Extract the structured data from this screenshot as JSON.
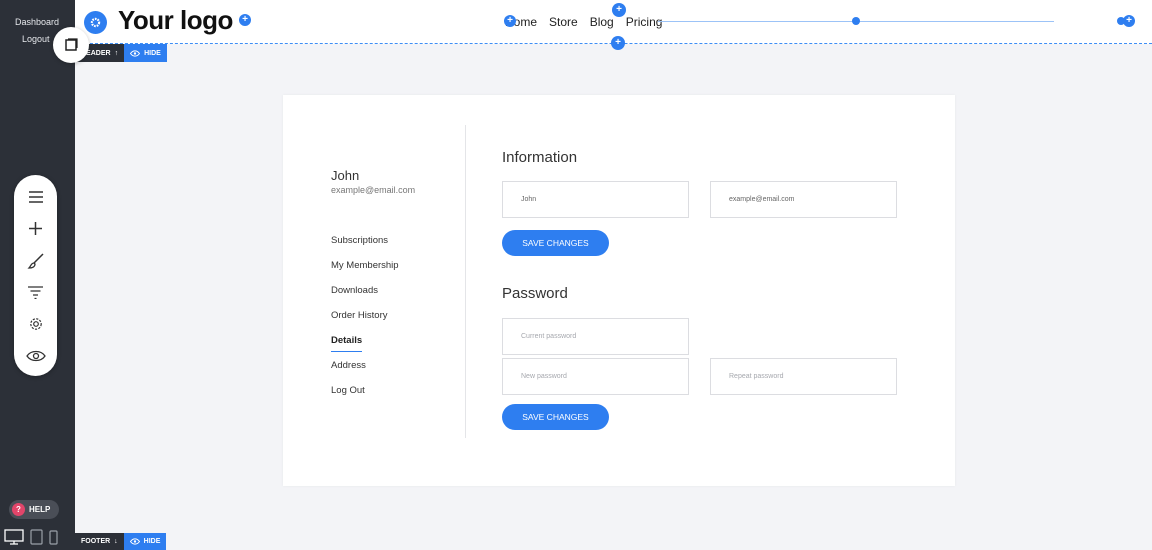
{
  "sidebar": {
    "dashboard_label": "Dashboard",
    "logout_label": "Logout",
    "help_label": "HELP",
    "help_icon": "?",
    "tools": [
      "menu-icon",
      "plus-icon",
      "brush-icon",
      "filter-icon",
      "gear-icon",
      "eye-icon"
    ]
  },
  "header": {
    "logo": "Your logo",
    "nav": [
      "Home",
      "Store",
      "Blog",
      "Pricing"
    ],
    "tag_label": "HEADER",
    "tag_arrow": "↑",
    "hide_label": "HIDE"
  },
  "footer": {
    "tag_label": "FOOTER",
    "tag_arrow": "↓",
    "hide_label": "HIDE"
  },
  "account": {
    "user_name": "John",
    "user_email": "example@email.com",
    "menu": [
      "Subscriptions",
      "My Membership",
      "Downloads",
      "Order History",
      "Details",
      "Address",
      "Log Out"
    ],
    "active_menu": "Details"
  },
  "information": {
    "title": "Information",
    "name_value": "John",
    "email_value": "example@email.com",
    "save_label": "SAVE CHANGES"
  },
  "password": {
    "title": "Password",
    "current_placeholder": "Current password",
    "new_placeholder": "New password",
    "repeat_placeholder": "Repeat password",
    "save_label": "SAVE CHANGES"
  },
  "colors": {
    "accent": "#2e7ef0",
    "sidebar_bg": "#2c3038",
    "page_bg": "#f3f4f7"
  }
}
